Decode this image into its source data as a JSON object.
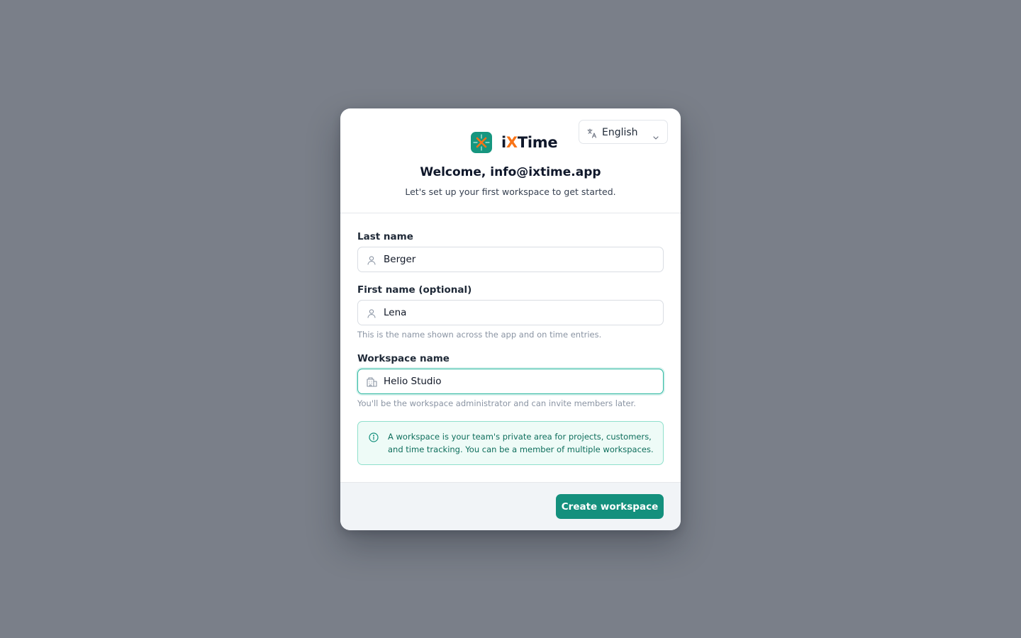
{
  "brand": {
    "name_prefix": "i",
    "name_accent": "X",
    "name_suffix": "Time",
    "logo_color": "#16967f",
    "accent_color": "#f97316",
    "logo_icon": "asterisk-cross-icon"
  },
  "language_select": {
    "selected": "English",
    "icon": "translate-icon"
  },
  "header": {
    "title": "Welcome, info@ixtime.app",
    "subtitle": "Let's set up your first workspace to get started."
  },
  "form": {
    "last_name": {
      "label": "Last name",
      "value": "Berger",
      "icon": "user-icon"
    },
    "first_name": {
      "label": "First name (optional)",
      "value": "Lena",
      "icon": "user-icon",
      "hint": "This is the name shown across the app and on time entries."
    },
    "workspace_name": {
      "label": "Workspace name",
      "value": "Helio Studio",
      "icon": "building-icon",
      "hint": "You'll be the workspace administrator and can invite members later.",
      "focused": true
    }
  },
  "info_box": {
    "icon": "info-icon",
    "text": "A workspace is your team's private area for projects, customers, and time tracking. You can be a member of multiple workspaces."
  },
  "footer": {
    "submit_label": "Create workspace",
    "primary_color": "#14907d"
  }
}
